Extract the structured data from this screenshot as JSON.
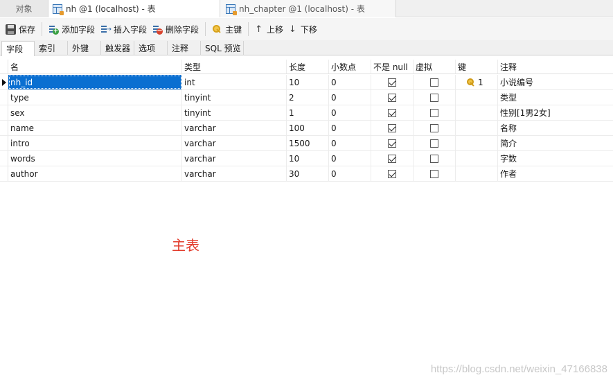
{
  "window_tabs": {
    "objects": "对象",
    "tab1": "nh @1 (localhost) - 表",
    "tab2": "nh_chapter @1 (localhost) - 表"
  },
  "toolbar": {
    "save": "保存",
    "add_field": "添加字段",
    "insert_field": "插入字段",
    "delete_field": "删除字段",
    "primary_key": "主键",
    "move_up": "上移",
    "move_down": "下移"
  },
  "subtabs": [
    "字段",
    "索引",
    "外键",
    "触发器",
    "选项",
    "注释",
    "SQL 预览"
  ],
  "columns": {
    "name": "名",
    "type": "类型",
    "length": "长度",
    "decimals": "小数点",
    "not_null": "不是 null",
    "virtual": "虚拟",
    "key": "键",
    "comment": "注释"
  },
  "rows": [
    {
      "name": "nh_id",
      "type": "int",
      "length": "10",
      "decimals": "0",
      "not_null": true,
      "virtual": false,
      "key": "1",
      "comment": "小说编号"
    },
    {
      "name": "type",
      "type": "tinyint",
      "length": "2",
      "decimals": "0",
      "not_null": true,
      "virtual": false,
      "key": "",
      "comment": "类型"
    },
    {
      "name": "sex",
      "type": "tinyint",
      "length": "1",
      "decimals": "0",
      "not_null": true,
      "virtual": false,
      "key": "",
      "comment": "性别[1男2女]"
    },
    {
      "name": "name",
      "type": "varchar",
      "length": "100",
      "decimals": "0",
      "not_null": true,
      "virtual": false,
      "key": "",
      "comment": "名称"
    },
    {
      "name": "intro",
      "type": "varchar",
      "length": "1500",
      "decimals": "0",
      "not_null": true,
      "virtual": false,
      "key": "",
      "comment": "简介"
    },
    {
      "name": "words",
      "type": "varchar",
      "length": "10",
      "decimals": "0",
      "not_null": true,
      "virtual": false,
      "key": "",
      "comment": "字数"
    },
    {
      "name": "author",
      "type": "varchar",
      "length": "30",
      "decimals": "0",
      "not_null": true,
      "virtual": false,
      "key": "",
      "comment": "作者"
    }
  ],
  "annotation": "主表",
  "watermark": "https://blog.csdn.net/weixin_47166838",
  "colors": {
    "selection": "#0a6fd1",
    "annotation": "#e23a2a",
    "key_icon": "#f0c445"
  }
}
